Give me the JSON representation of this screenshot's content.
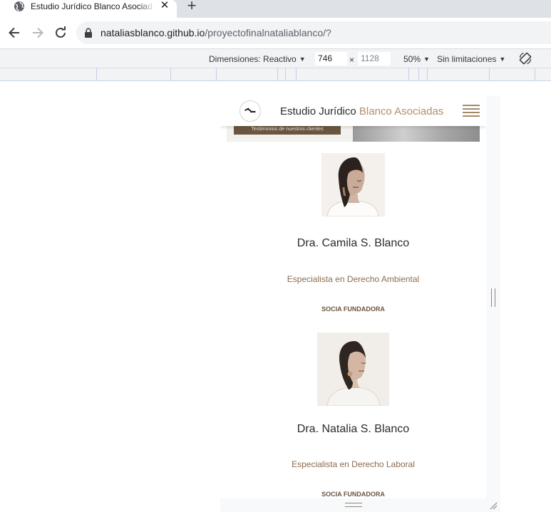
{
  "browser": {
    "tab": {
      "title": "Estudio Jurídico Blanco Asociadas",
      "close_glyph": "✕",
      "favicon": "globe-icon"
    },
    "new_tab_glyph": "+",
    "address": {
      "host": "nataliasblanco.github.io",
      "path": "/proyectofinalnataliablanco/?"
    }
  },
  "devtools": {
    "dimensions_label": "Dimensiones: Reactivo",
    "width": "746",
    "times": "×",
    "height": "1128",
    "zoom": "50%",
    "throttle": "Sin limitaciones"
  },
  "site": {
    "brand_main": "Estudio Jurídico ",
    "brand_accent": "Blanco Asociadas",
    "previous_button": "Testimonios de nuestros clientes",
    "colors": {
      "brand": "#b0906a",
      "accent_dark": "#6b5440"
    },
    "members": [
      {
        "name": "Dra. Camila S. Blanco",
        "specialty": "Especialista en Derecho Ambiental",
        "role": "SOCIA FUNDADORA"
      },
      {
        "name": "Dra. Natalia S. Blanco",
        "specialty": "Especialista en Derecho Laboral",
        "role": "SOCIA FUNDADORA"
      }
    ]
  }
}
